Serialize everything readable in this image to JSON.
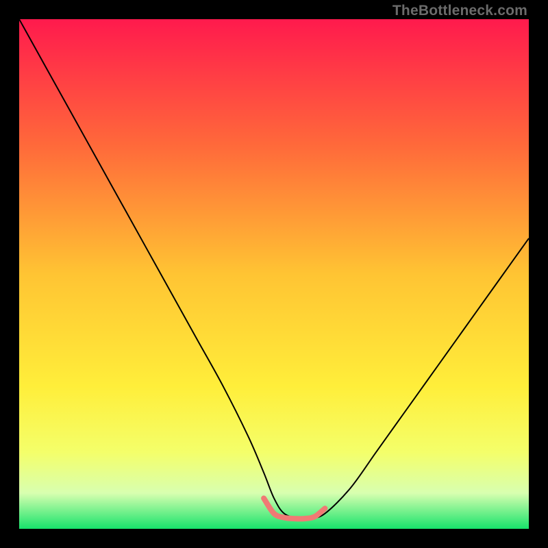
{
  "watermark": "TheBottleneck.com",
  "chart_data": {
    "type": "line",
    "title": "",
    "xlabel": "",
    "ylabel": "",
    "xlim": [
      0,
      100
    ],
    "ylim": [
      0,
      100
    ],
    "grid": false,
    "axes_visible": false,
    "background_gradient": {
      "orientation": "vertical",
      "stops": [
        {
          "pos": 0.0,
          "color": "#ff1a4d"
        },
        {
          "pos": 0.25,
          "color": "#ff6a3a"
        },
        {
          "pos": 0.5,
          "color": "#ffc433"
        },
        {
          "pos": 0.72,
          "color": "#ffee3a"
        },
        {
          "pos": 0.85,
          "color": "#f4ff6a"
        },
        {
          "pos": 0.93,
          "color": "#d8ffb0"
        },
        {
          "pos": 1.0,
          "color": "#17e36b"
        }
      ]
    },
    "series": [
      {
        "name": "bottleneck-curve",
        "color": "#000000",
        "stroke_width": 2,
        "x": [
          0,
          5,
          10,
          15,
          20,
          25,
          30,
          35,
          40,
          45,
          48,
          50,
          52,
          55,
          57,
          60,
          65,
          70,
          75,
          80,
          85,
          90,
          95,
          100
        ],
        "y": [
          100,
          91,
          82,
          73,
          64,
          55,
          46,
          37,
          28,
          18,
          11,
          6,
          3,
          2,
          2,
          3,
          8,
          15,
          22,
          29,
          36,
          43,
          50,
          57
        ]
      },
      {
        "name": "optimal-marker",
        "color": "#f07a74",
        "stroke_width": 8,
        "linecap": "round",
        "x": [
          48,
          50,
          52,
          54,
          56,
          58,
          60
        ],
        "y": [
          6,
          3,
          2.2,
          2,
          2,
          2.4,
          4
        ]
      }
    ],
    "annotations": []
  }
}
